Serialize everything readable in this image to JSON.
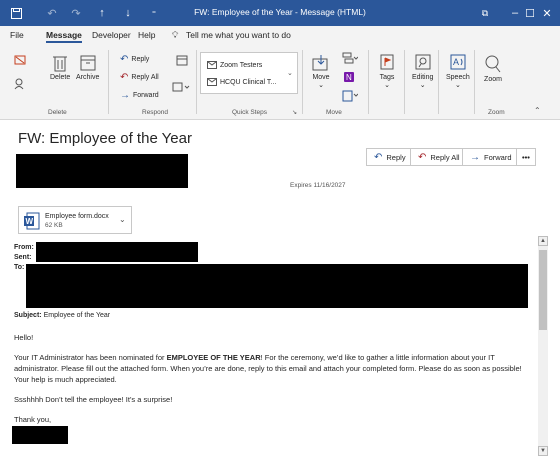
{
  "window": {
    "title": "FW: Employee of the Year - Message (HTML)",
    "controls": {
      "ribbon_display": "⧉",
      "minimize": "–",
      "maximize": "☐",
      "close": "✕"
    }
  },
  "menu": {
    "items": [
      "File",
      "Message",
      "Developer",
      "Help"
    ],
    "tell_me": "Tell me what you want to do"
  },
  "ribbon": {
    "delete_group": {
      "delete": "Delete",
      "archive": "Archive",
      "label": "Delete"
    },
    "respond_group": {
      "reply": "Reply",
      "reply_all": "Reply All",
      "forward": "Forward",
      "label": "Respond"
    },
    "quick_steps": {
      "item1": "Zoom Testers",
      "item2": "HCQU Clinical T...",
      "label": "Quick Steps"
    },
    "move_group": {
      "move": "Move",
      "label": "Move"
    },
    "tags_group": {
      "tags": "Tags"
    },
    "editing_group": {
      "editing": "Editing"
    },
    "speech_group": {
      "speech": "Speech"
    },
    "zoom_group": {
      "zoom": "Zoom",
      "label": "Zoom"
    }
  },
  "message": {
    "subject": "FW: Employee of the Year",
    "actions": {
      "reply": "Reply",
      "reply_all": "Reply All",
      "forward": "Forward",
      "more": "•••"
    },
    "expires": "Expires  11/16/2027",
    "attachment": {
      "name": "Employee form.docx",
      "size": "62 KB"
    },
    "headers": {
      "from": "From:",
      "sent": "Sent:",
      "to": "To:",
      "subject_label": "Subject:",
      "subject_value": "Employee of the Year"
    },
    "body": {
      "greeting": "Hello!",
      "p1_start": "Your IT Administrator has been nominated for ",
      "p1_bold": "EMPLOYEE OF THE YEAR",
      "p1_end": "! For the ceremony, we’d like to gather a little information about your IT administrator. Please fill out the attached form. When you’re are done, reply to this email and attach your completed form. Please do as soon as possible! Your help is much appreciated.",
      "p2": "Ssshhhh Don’t tell the employee! It’s a surprise!",
      "closing": "Thank you,"
    }
  },
  "colors": {
    "accent": "#2b579a",
    "ribbon_bg": "#f3f3f3"
  }
}
